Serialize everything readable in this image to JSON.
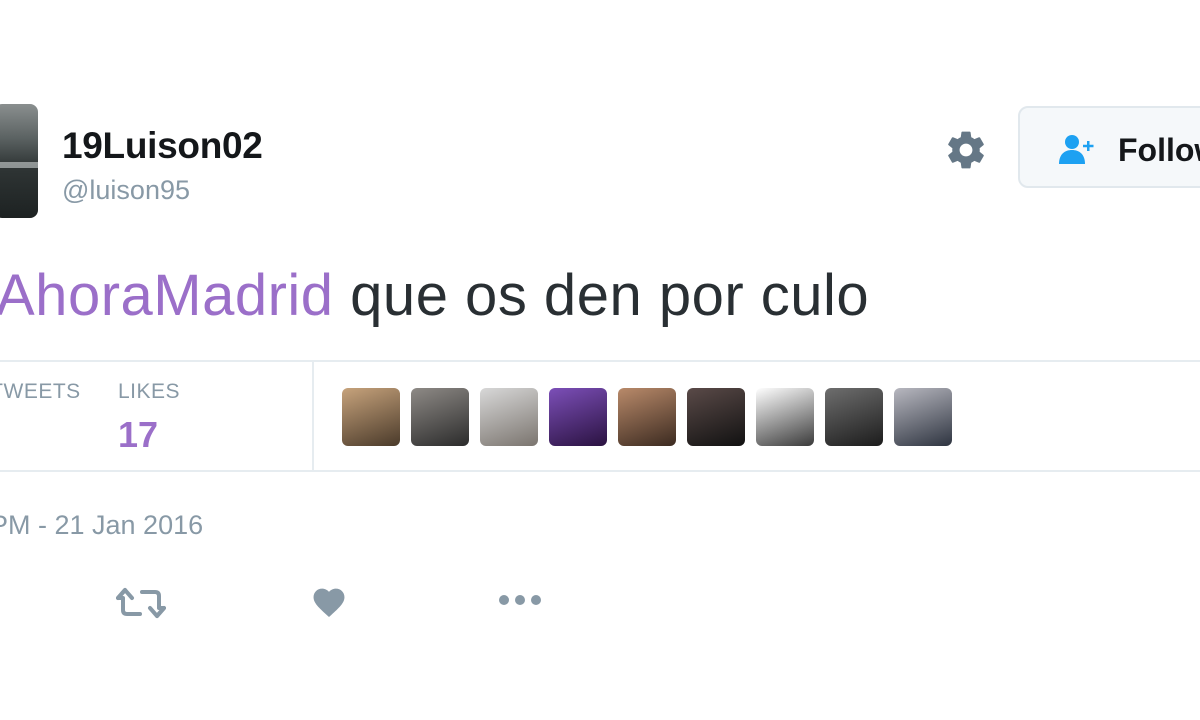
{
  "user": {
    "display_name": "19Luison02",
    "screen_name": "@luison95"
  },
  "header": {
    "gear_icon": "gear-icon",
    "follow_label": "Follow"
  },
  "tweet": {
    "hashtag": "AhoraMadrid",
    "text": " que os den por culo"
  },
  "stats": {
    "retweets_label": "RETWEETS",
    "likes_label": "LIKES",
    "likes_count": "17"
  },
  "likers": [
    {
      "name": "liker-1",
      "colors": [
        "#c7a37c",
        "#4a3a2a"
      ]
    },
    {
      "name": "liker-2",
      "colors": [
        "#8e8a86",
        "#2b2b2b"
      ]
    },
    {
      "name": "liker-3",
      "colors": [
        "#d8d8d8",
        "#7a746e"
      ]
    },
    {
      "name": "liker-4",
      "colors": [
        "#7c4fb8",
        "#2a1240"
      ]
    },
    {
      "name": "liker-5",
      "colors": [
        "#b98a6a",
        "#3b2a20"
      ]
    },
    {
      "name": "liker-6",
      "colors": [
        "#5a4a48",
        "#111111"
      ]
    },
    {
      "name": "liker-7",
      "colors": [
        "#ffffff",
        "#3a3a3a"
      ]
    },
    {
      "name": "liker-8",
      "colors": [
        "#6e6e6e",
        "#1c1c1c"
      ]
    },
    {
      "name": "liker-9",
      "colors": [
        "#b8b8c0",
        "#2e3440"
      ]
    }
  ],
  "timestamp": "PM - 21 Jan 2016",
  "actions": {
    "retweet_icon": "retweet-icon",
    "like_icon": "heart-icon",
    "more_icon": "more-icon"
  },
  "colors": {
    "hashtag": "#9b6fc9",
    "muted": "#8899a6",
    "text": "#292f33",
    "follow_icon": "#1da1f2"
  }
}
